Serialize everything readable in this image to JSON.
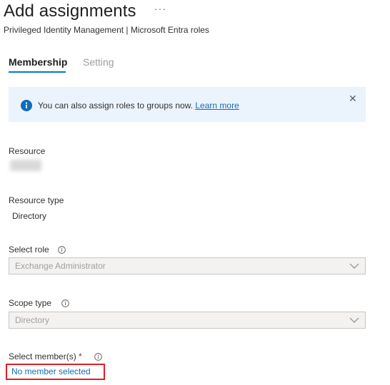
{
  "header": {
    "title": "Add assignments",
    "more_label": "···",
    "subtitle": "Privileged Identity Management | Microsoft Entra roles"
  },
  "tabs": [
    {
      "label": "Membership",
      "active": true
    },
    {
      "label": "Setting",
      "active": false
    }
  ],
  "banner": {
    "text": "You can also assign roles to groups now.",
    "link": "Learn more",
    "close_label": "✕"
  },
  "form": {
    "resource": {
      "label": "Resource",
      "value_obscured": true
    },
    "resource_type": {
      "label": "Resource type",
      "value": "Directory"
    },
    "select_role": {
      "label": "Select role",
      "value": "Exchange Administrator"
    },
    "scope_type": {
      "label": "Scope type",
      "value": "Directory"
    },
    "select_members": {
      "label": "Select member(s)",
      "required_mark": "*",
      "link": "No member selected"
    }
  },
  "colors": {
    "accent": "#0078d4",
    "link": "#0f6cbd",
    "banner_bg": "#ebf3fc",
    "highlight_border": "#e01e26"
  },
  "icons": [
    "more-icon",
    "info-icon",
    "close-icon",
    "chevron-down-icon"
  ]
}
